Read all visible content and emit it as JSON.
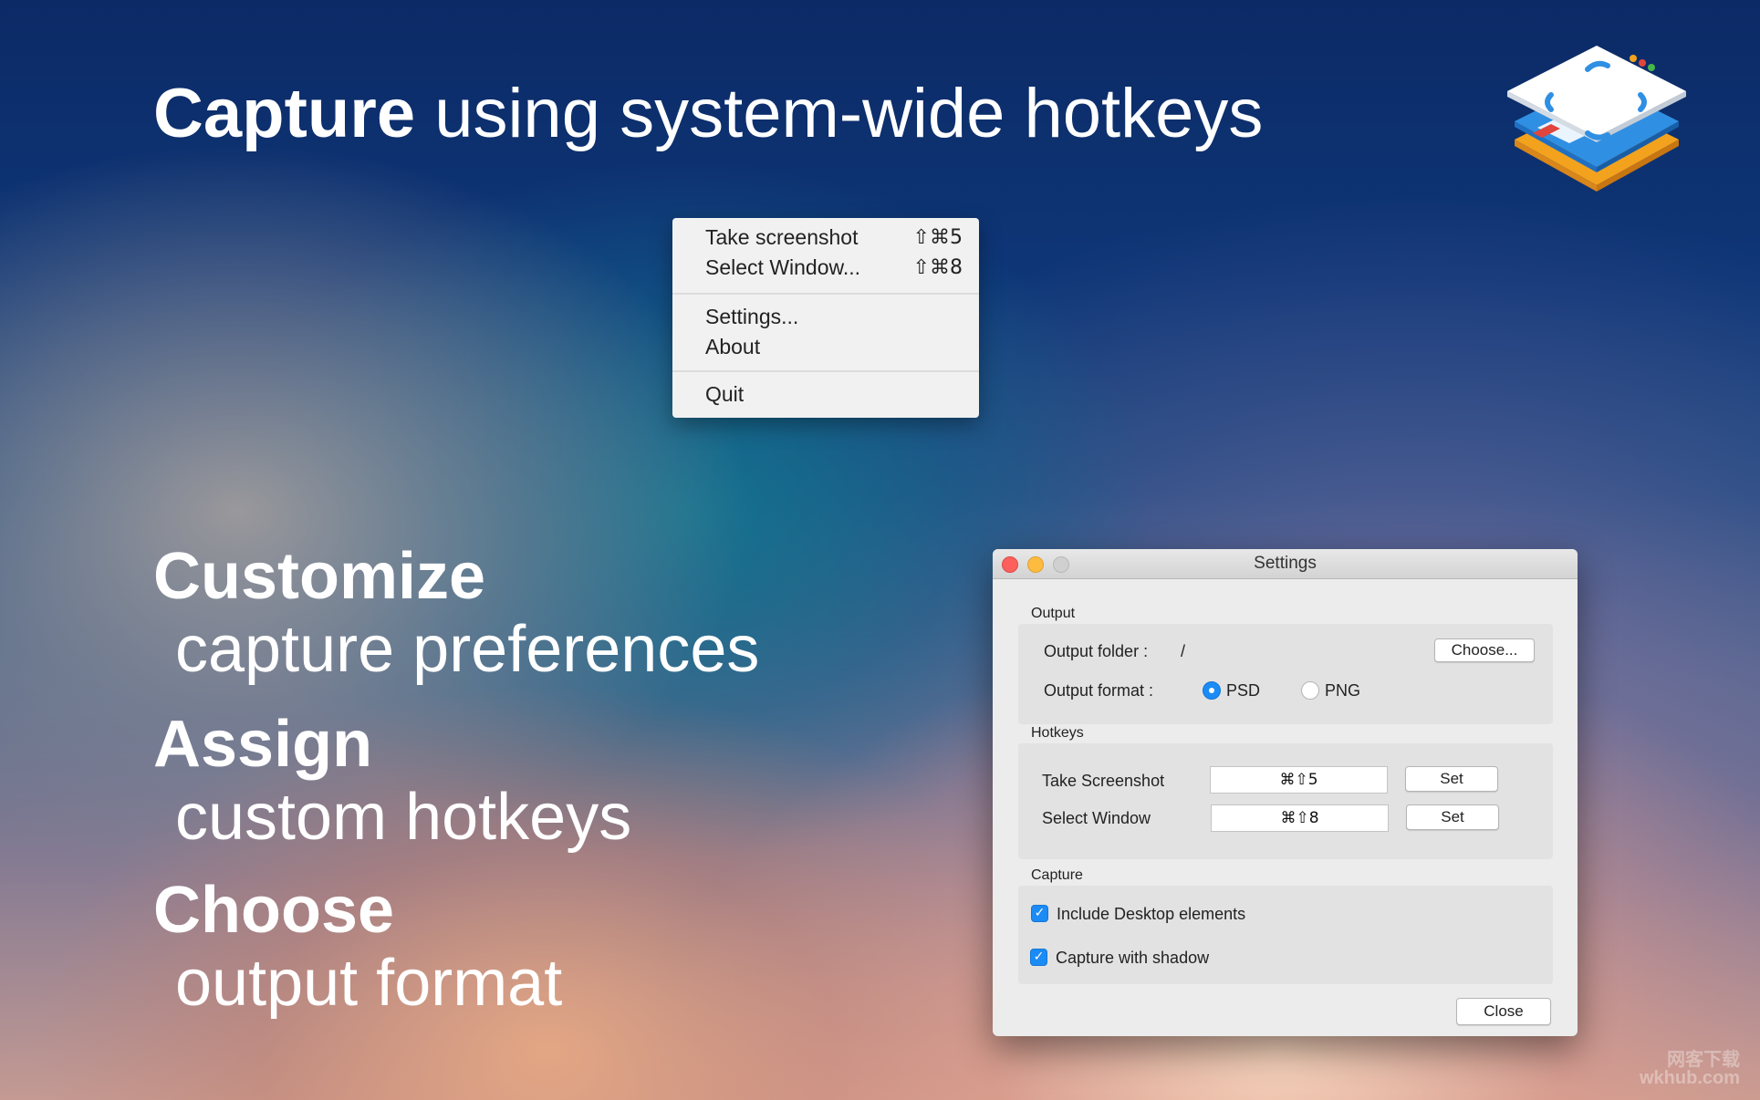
{
  "hero": {
    "bold": "Capture",
    "light": " using system-wide hotkeys"
  },
  "features": [
    {
      "bold": "Customize",
      "light": "capture preferences"
    },
    {
      "bold": "Assign",
      "light": "custom hotkeys"
    },
    {
      "bold": "Choose",
      "light": "output format"
    }
  ],
  "app_icon": {
    "name": "screenshot-layers-icon"
  },
  "menu": {
    "items": [
      {
        "label": "Take screenshot",
        "shortcut": "⇧⌘5"
      },
      {
        "label": "Select Window...",
        "shortcut": "⇧⌘8"
      },
      {
        "label": "Settings...",
        "shortcut": ""
      },
      {
        "label": "About",
        "shortcut": ""
      },
      {
        "label": "Quit",
        "shortcut": ""
      }
    ]
  },
  "settings": {
    "title": "Settings",
    "output": {
      "section": "Output",
      "folder_label": "Output folder :",
      "folder_value": "/",
      "choose_label": "Choose...",
      "format_label": "Output format :",
      "formats": [
        {
          "label": "PSD",
          "selected": true
        },
        {
          "label": "PNG",
          "selected": false
        }
      ]
    },
    "hotkeys": {
      "section": "Hotkeys",
      "rows": [
        {
          "label": "Take Screenshot",
          "value": "⌘⇧5",
          "button": "Set"
        },
        {
          "label": "Select Window",
          "value": "⌘⇧8",
          "button": "Set"
        }
      ]
    },
    "capture": {
      "section": "Capture",
      "options": [
        {
          "label": "Include Desktop elements",
          "checked": true
        },
        {
          "label": "Capture with shadow",
          "checked": true
        }
      ]
    },
    "close_label": "Close"
  },
  "watermark": {
    "line1": "网客下载",
    "line2": "wkhub.com"
  },
  "colors": {
    "accent": "#1b8bf5",
    "close": "#fc605c",
    "minimize": "#fdbc40",
    "menu_bg": "#f1f1f1",
    "window_bg": "#ececec"
  }
}
